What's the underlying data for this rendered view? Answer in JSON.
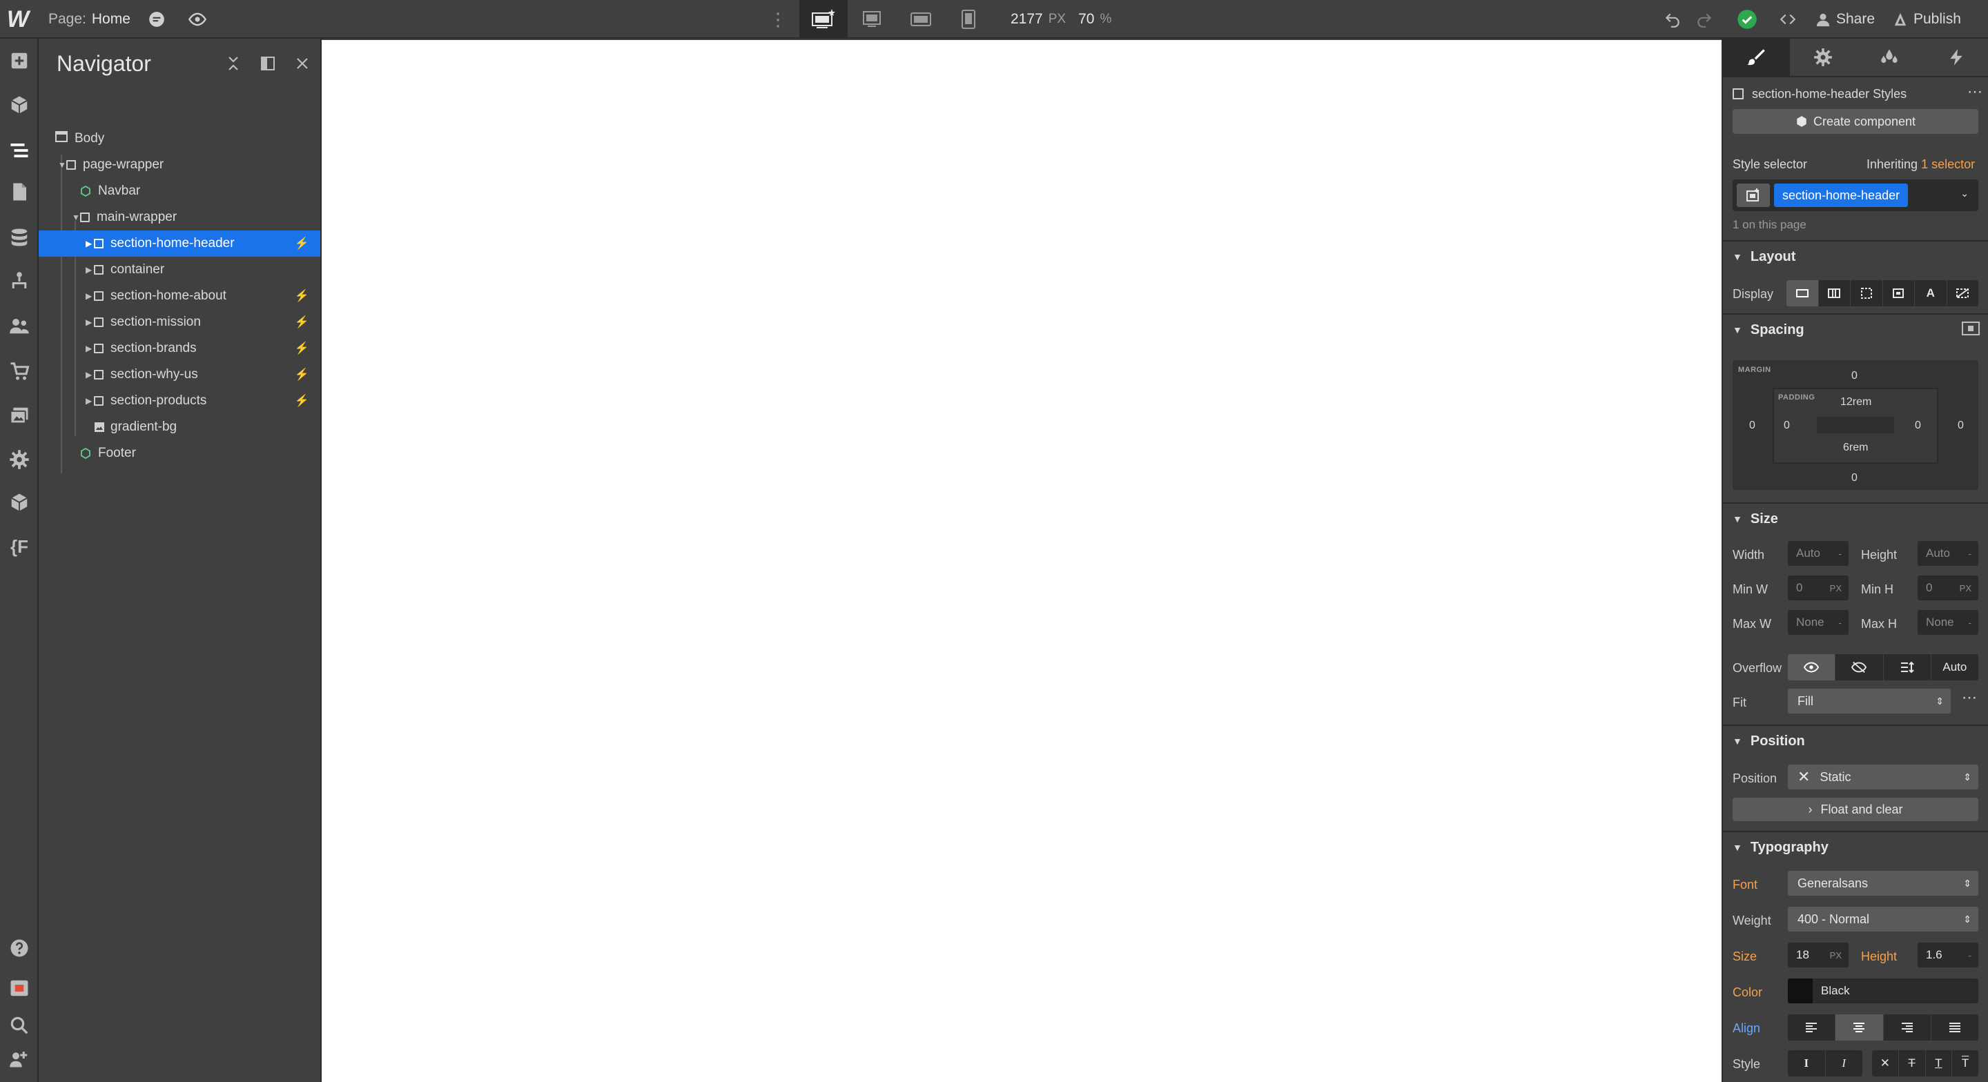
{
  "topbar": {
    "logo": "W",
    "page_label": "Page:",
    "page_name": "Home",
    "width_value": "2177",
    "width_unit": "PX",
    "zoom_value": "70",
    "zoom_unit": "%",
    "share": "Share",
    "publish": "Publish"
  },
  "navigator": {
    "title": "Navigator",
    "items": [
      {
        "label": "Body"
      },
      {
        "label": "page-wrapper"
      },
      {
        "label": "Navbar"
      },
      {
        "label": "main-wrapper"
      },
      {
        "label": "section-home-header"
      },
      {
        "label": "container"
      },
      {
        "label": "section-home-about"
      },
      {
        "label": "section-mission"
      },
      {
        "label": "section-brands"
      },
      {
        "label": "section-why-us"
      },
      {
        "label": "section-products"
      },
      {
        "label": "gradient-bg"
      },
      {
        "label": "Footer"
      }
    ]
  },
  "style_panel": {
    "styles_title": "section-home-header Styles",
    "create_component": "Create component",
    "style_selector_label": "Style selector",
    "inheriting_prefix": "Inheriting",
    "inheriting_link": "1 selector",
    "selector_chip": "section-home-header",
    "on_page": "1 on this page",
    "layout": {
      "title": "Layout",
      "display_label": "Display"
    },
    "spacing": {
      "title": "Spacing",
      "margin_label": "MARGIN",
      "padding_label": "PADDING",
      "margin_top": "0",
      "margin_right": "0",
      "margin_bottom": "0",
      "margin_left": "0",
      "padding_top": "12rem",
      "padding_right": "0",
      "padding_bottom": "6rem",
      "padding_left": "0"
    },
    "size": {
      "title": "Size",
      "width_label": "Width",
      "width_value": "Auto",
      "height_label": "Height",
      "height_value": "Auto",
      "minw_label": "Min W",
      "minw_value": "0",
      "minw_unit": "PX",
      "minh_label": "Min H",
      "minh_value": "0",
      "minh_unit": "PX",
      "maxw_label": "Max W",
      "maxw_value": "None",
      "maxh_label": "Max H",
      "maxh_value": "None",
      "overflow_label": "Overflow",
      "overflow_auto": "Auto",
      "fit_label": "Fit",
      "fit_value": "Fill"
    },
    "position": {
      "title": "Position",
      "position_label": "Position",
      "position_value": "Static",
      "float_clear": "Float and clear"
    },
    "typography": {
      "title": "Typography",
      "font_label": "Font",
      "font_value": "Generalsans",
      "weight_label": "Weight",
      "weight_value": "400 - Normal",
      "size_label": "Size",
      "size_value": "18",
      "size_unit": "PX",
      "height_label": "Height",
      "height_value": "1.6",
      "color_label": "Color",
      "color_value": "Black",
      "align_label": "Align",
      "style_label": "Style"
    }
  },
  "colors": {
    "accent": "#1a73e8",
    "success": "#2ea84f",
    "changed_label": "#f6a04d",
    "inherited_label": "#6aa6ff"
  }
}
